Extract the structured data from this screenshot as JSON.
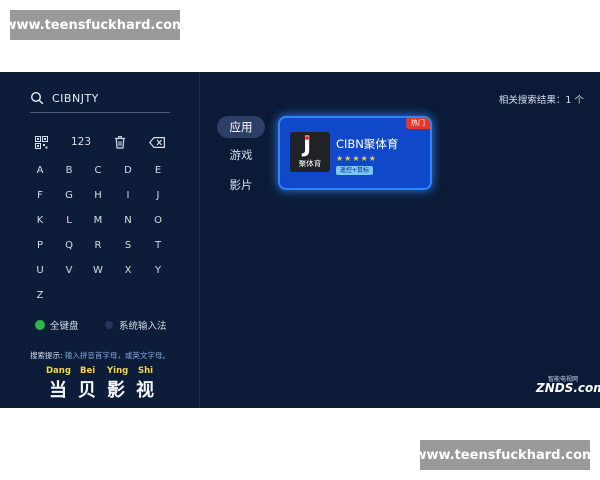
{
  "watermarks": {
    "top": "www.teensfuckhard.com",
    "bottom": "www.teensfuckhard.com"
  },
  "search": {
    "value": "CIBNJTY",
    "icon": "search-icon"
  },
  "toolbar": {
    "qr_icon": "qr-code-icon",
    "numbers_label": "123",
    "delete_icon": "trash-icon",
    "backspace_icon": "backspace-icon"
  },
  "keyboard": {
    "rows": [
      [
        "A",
        "B",
        "C",
        "D",
        "E"
      ],
      [
        "F",
        "G",
        "H",
        "I",
        "J"
      ],
      [
        "K",
        "L",
        "M",
        "N",
        "O"
      ],
      [
        "P",
        "Q",
        "R",
        "S",
        "T"
      ],
      [
        "U",
        "V",
        "W",
        "X",
        "Y"
      ],
      [
        "Z"
      ]
    ]
  },
  "input_modes": {
    "full_keyboard": "全键盘",
    "system_input": "系统输入法"
  },
  "hint": {
    "label": "搜索提示:",
    "text": "输入拼音首字母，或英文字母。"
  },
  "brand": {
    "pinyin": [
      "Dang",
      "Bei",
      "Ying",
      "Shi"
    ],
    "chars": [
      "当",
      "贝",
      "影",
      "视"
    ]
  },
  "categories": [
    "应用",
    "游戏",
    "影片"
  ],
  "result_count": "相关搜索结果：1 个",
  "app": {
    "name": "CIBN聚体育",
    "icon_letter": "J",
    "icon_text": "聚体育",
    "stars": "★★★★★",
    "tag": "遥控+鼠标",
    "badge": "热门"
  },
  "znds": {
    "top": "智能电视网",
    "main": "ZNDS.com"
  },
  "colors": {
    "screen_bg": "#0b1a36",
    "card_bg": "#0f48c9",
    "card_glow": "#2e86ff",
    "active_dot": "#2db84d",
    "badge": "#e3382c"
  }
}
